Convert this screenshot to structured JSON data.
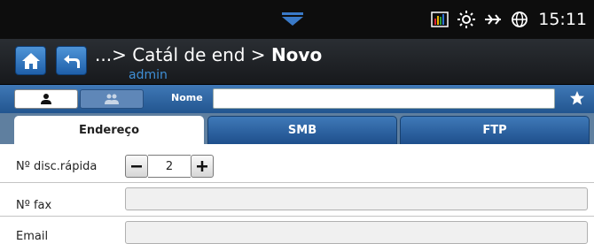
{
  "status": {
    "time": "15:11",
    "icons": [
      "pulldown-arrow-icon",
      "data-usage-icon",
      "brightness-icon",
      "network-icon",
      "globe-icon"
    ]
  },
  "header": {
    "path_prefix": "...> Catál de end > ",
    "title_bold": "Novo",
    "user": "admin"
  },
  "name_row": {
    "label": "Nome",
    "value": ""
  },
  "tabs": [
    {
      "label": "Endereço",
      "active": true
    },
    {
      "label": "SMB",
      "active": false
    },
    {
      "label": "FTP",
      "active": false
    }
  ],
  "form": {
    "speed_dial": {
      "label": "Nº disc.rápida",
      "value": "2"
    },
    "fax": {
      "label": "Nº fax",
      "value": ""
    },
    "email": {
      "label": "Email",
      "value": ""
    }
  },
  "colors": {
    "accent_blue": "#1f5fa8",
    "user_text": "#3f8fd6"
  }
}
